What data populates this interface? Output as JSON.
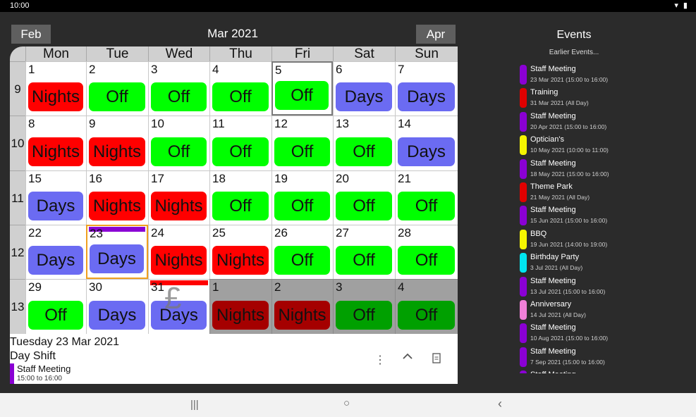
{
  "status": {
    "time": "10:00",
    "icons": "▾ ▮"
  },
  "header": {
    "prev_label": "Feb",
    "next_label": "Apr",
    "title": "Mar 2021"
  },
  "calendar": {
    "days_of_week": [
      "Mon",
      "Tue",
      "Wed",
      "Thu",
      "Fri",
      "Sat",
      "Sun"
    ],
    "weeks": [
      {
        "week": "9",
        "days": [
          {
            "day": "1",
            "shift": "Nights"
          },
          {
            "day": "2",
            "shift": "Off"
          },
          {
            "day": "3",
            "shift": "Off"
          },
          {
            "day": "4",
            "shift": "Off"
          },
          {
            "day": "5",
            "shift": "Off",
            "today": true
          },
          {
            "day": "6",
            "shift": "Days"
          },
          {
            "day": "7",
            "shift": "Days"
          }
        ]
      },
      {
        "week": "10",
        "days": [
          {
            "day": "8",
            "shift": "Nights"
          },
          {
            "day": "9",
            "shift": "Nights"
          },
          {
            "day": "10",
            "shift": "Off"
          },
          {
            "day": "11",
            "shift": "Off"
          },
          {
            "day": "12",
            "shift": "Off"
          },
          {
            "day": "13",
            "shift": "Off"
          },
          {
            "day": "14",
            "shift": "Days"
          }
        ]
      },
      {
        "week": "11",
        "days": [
          {
            "day": "15",
            "shift": "Days"
          },
          {
            "day": "16",
            "shift": "Nights"
          },
          {
            "day": "17",
            "shift": "Nights"
          },
          {
            "day": "18",
            "shift": "Off"
          },
          {
            "day": "19",
            "shift": "Off"
          },
          {
            "day": "20",
            "shift": "Off"
          },
          {
            "day": "21",
            "shift": "Off"
          }
        ]
      },
      {
        "week": "12",
        "days": [
          {
            "day": "22",
            "shift": "Days"
          },
          {
            "day": "23",
            "shift": "Days",
            "selected": true,
            "event_color": "#8a00d4"
          },
          {
            "day": "24",
            "shift": "Nights"
          },
          {
            "day": "25",
            "shift": "Nights"
          },
          {
            "day": "26",
            "shift": "Off"
          },
          {
            "day": "27",
            "shift": "Off"
          },
          {
            "day": "28",
            "shift": "Off"
          }
        ]
      },
      {
        "week": "13",
        "days": [
          {
            "day": "29",
            "shift": "Off"
          },
          {
            "day": "30",
            "shift": "Days"
          },
          {
            "day": "31",
            "shift": "Days",
            "event_color": "#ff0000",
            "pound": "£"
          },
          {
            "day": "1",
            "shift": "Nights",
            "dim": true
          },
          {
            "day": "2",
            "shift": "Nights",
            "dim": true
          },
          {
            "day": "3",
            "shift": "Off",
            "dim": true
          },
          {
            "day": "4",
            "shift": "Off",
            "dim": true
          }
        ]
      }
    ],
    "shift_colors": {
      "Nights": "#ff0000",
      "Off": "#00ff00",
      "Days": "#6b6bf2",
      "Nights_dim": "#a50000",
      "Off_dim": "#00a000",
      "Days_dim": "#4a4aa8"
    }
  },
  "detail": {
    "date": "Tuesday 23 Mar 2021",
    "shift": "Day Shift",
    "event_title": "Staff Meeting",
    "event_time": "15:00 to 16:00",
    "actions": [
      "more-vert-icon",
      "chevron-up-icon",
      "note-icon"
    ]
  },
  "events_panel": {
    "title": "Events",
    "earlier_label": "Earlier Events...",
    "items": [
      {
        "title": "Staff Meeting",
        "sub": "23 Mar 2021 (15:00 to 16:00)",
        "color": "#8a00d4"
      },
      {
        "title": "Training",
        "sub": "31 Mar 2021 (All Day)",
        "color": "#e00000"
      },
      {
        "title": "Staff Meeting",
        "sub": "20 Apr 2021 (15:00 to 16:00)",
        "color": "#8a00d4"
      },
      {
        "title": "Optician's",
        "sub": "10 May 2021 (10:00 to 11:00)",
        "color": "#f5f500"
      },
      {
        "title": "Staff Meeting",
        "sub": "18 May 2021 (15:00 to 16:00)",
        "color": "#8a00d4"
      },
      {
        "title": "Theme Park",
        "sub": "21 May 2021 (All Day)",
        "color": "#e00000"
      },
      {
        "title": "Staff Meeting",
        "sub": "15 Jun 2021 (15:00 to 16:00)",
        "color": "#8a00d4"
      },
      {
        "title": "BBQ",
        "sub": "19 Jun 2021 (14:00 to 19:00)",
        "color": "#f5f500"
      },
      {
        "title": "Birthday Party",
        "sub": "3 Jul 2021 (All Day)",
        "color": "#00e5f0"
      },
      {
        "title": "Staff Meeting",
        "sub": "13 Jul 2021 (15:00 to 16:00)",
        "color": "#8a00d4"
      },
      {
        "title": "Anniversary",
        "sub": "14 Jul 2021 (All Day)",
        "color": "#f080d8"
      },
      {
        "title": "Staff Meeting",
        "sub": "10 Aug 2021 (15:00 to 16:00)",
        "color": "#8a00d4"
      },
      {
        "title": "Staff Meeting",
        "sub": "7 Sep 2021 (15:00 to 16:00)",
        "color": "#8a00d4"
      },
      {
        "title": "Staff Meeting",
        "sub": "",
        "color": "#8a00d4"
      }
    ]
  },
  "navbar": {
    "recent": "|||",
    "home": "○",
    "back": "‹"
  }
}
